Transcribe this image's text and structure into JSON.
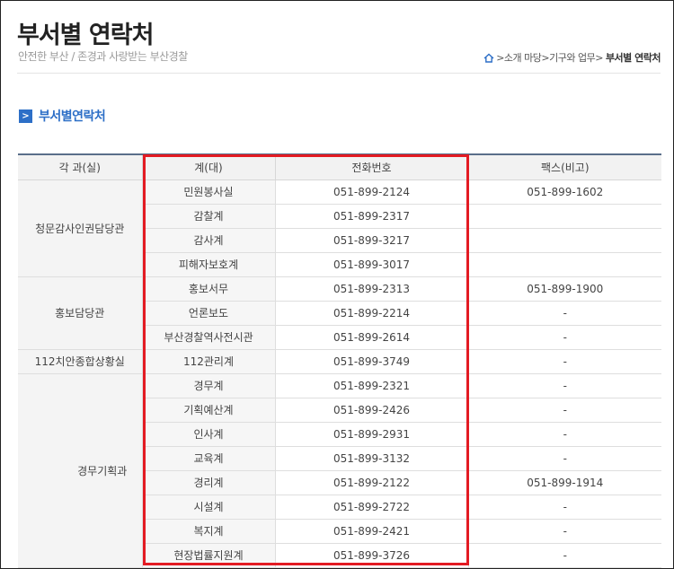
{
  "header": {
    "title": "부서별 연락처",
    "subtitle": "안전한 부산 / 존경과 사랑받는 부산경찰",
    "breadcrumb": [
      ">소개 마당",
      ">기구와 업무",
      ">"
    ],
    "breadcrumb_current": "부서별 연락처"
  },
  "section": {
    "icon": ">",
    "title": "부서별연락처"
  },
  "table": {
    "headers": [
      "각 과(실)",
      "계(대)",
      "전화번호",
      "팩스(비고)"
    ],
    "groups": [
      {
        "name": "청문감사인권담당관",
        "rows": [
          {
            "gye": "민원봉사실",
            "tel": "051-899-2124",
            "fax": "051-899-1602"
          },
          {
            "gye": "감찰계",
            "tel": "051-899-2317",
            "fax": ""
          },
          {
            "gye": "감사계",
            "tel": "051-899-3217",
            "fax": ""
          },
          {
            "gye": "피해자보호계",
            "tel": "051-899-3017",
            "fax": ""
          }
        ]
      },
      {
        "name": "홍보담당관",
        "rows": [
          {
            "gye": "홍보서무",
            "tel": "051-899-2313",
            "fax": "051-899-1900"
          },
          {
            "gye": "언론보도",
            "tel": "051-899-2214",
            "fax": "-"
          },
          {
            "gye": "부산경찰역사전시관",
            "tel": "051-899-2614",
            "fax": "-"
          }
        ]
      },
      {
        "name": "112치안종합상황실",
        "rows": [
          {
            "gye": "112관리계",
            "tel": "051-899-3749",
            "fax": "-"
          }
        ]
      },
      {
        "name": "경무기획과",
        "rows": [
          {
            "gye": "경무계",
            "tel": "051-899-2321",
            "fax": "-"
          },
          {
            "gye": "기획예산계",
            "tel": "051-899-2426",
            "fax": "-"
          },
          {
            "gye": "인사계",
            "tel": "051-899-2931",
            "fax": "-"
          },
          {
            "gye": "교육계",
            "tel": "051-899-3132",
            "fax": "-"
          },
          {
            "gye": "경리계",
            "tel": "051-899-2122",
            "fax": "051-899-1914"
          },
          {
            "gye": "시설계",
            "tel": "051-899-2722",
            "fax": "-"
          },
          {
            "gye": "복지계",
            "tel": "051-899-2421",
            "fax": "-"
          },
          {
            "gye": "현장법률지원계",
            "tel": "051-899-3726",
            "fax": "-"
          }
        ]
      }
    ]
  },
  "colors": {
    "accent": "#2d6fc7",
    "highlight": "#e31b23",
    "table_top_border": "#5a6e8a"
  }
}
